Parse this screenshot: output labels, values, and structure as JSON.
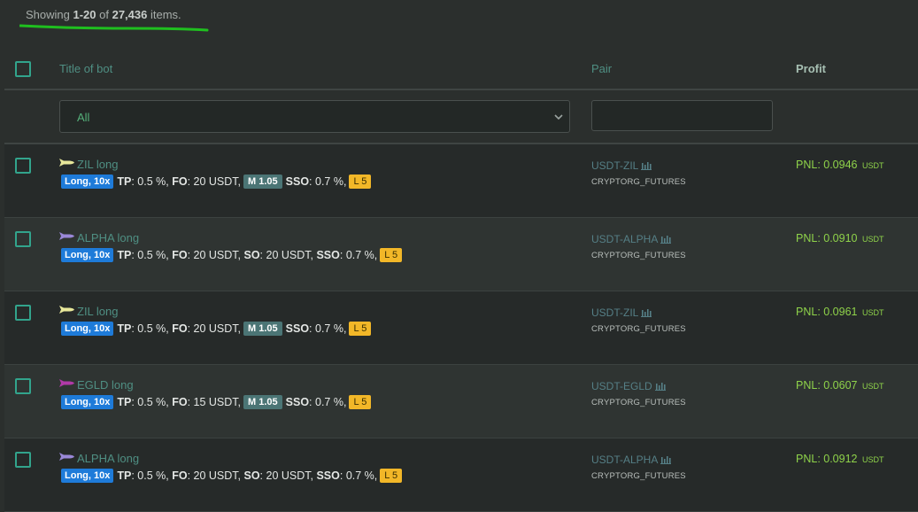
{
  "summary": {
    "prefix": "Showing ",
    "range": "1-20",
    "of": " of ",
    "total": "27,436",
    "suffix": " items."
  },
  "table": {
    "headers": {
      "title": "Title of bot",
      "pair": "Pair",
      "profit": "Profit"
    },
    "filter": {
      "select_value": "All",
      "pair_value": ""
    }
  },
  "rows": [
    {
      "icon_color": "#e8e89a",
      "title": "ZIL long",
      "direction": "Long, 10x",
      "tp_label": "TP",
      "tp": ": 0.5 %,",
      "fo_label": "FO",
      "fo": ": 20 USDT,",
      "m_badge": "M 1.05",
      "sso_label": "SSO",
      "sso": ": 0.7 %,",
      "l_badge": "L 5",
      "pair": "USDT-ZIL",
      "exchange": "CRYPTORG_FUTURES",
      "pnl": "PNL: 0.0946",
      "unit": "USDT"
    },
    {
      "icon_color": "#9a88d8",
      "title": "ALPHA long",
      "direction": "Long, 10x",
      "tp_label": "TP",
      "tp": ": 0.5 %,",
      "fo_label": "FO",
      "fo": ": 20 USDT,",
      "so_label": "SO",
      "so": ": 20 USDT,",
      "sso_label": "SSO",
      "sso": ": 0.7 %,",
      "l_badge": "L 5",
      "pair": "USDT-ALPHA",
      "exchange": "CRYPTORG_FUTURES",
      "pnl": "PNL: 0.0910",
      "unit": "USDT"
    },
    {
      "icon_color": "#e8e89a",
      "title": "ZIL long",
      "direction": "Long, 10x",
      "tp_label": "TP",
      "tp": ": 0.5 %,",
      "fo_label": "FO",
      "fo": ": 20 USDT,",
      "m_badge": "M 1.05",
      "sso_label": "SSO",
      "sso": ": 0.7 %,",
      "l_badge": "L 5",
      "pair": "USDT-ZIL",
      "exchange": "CRYPTORG_FUTURES",
      "pnl": "PNL: 0.0961",
      "unit": "USDT"
    },
    {
      "icon_color": "#b13aa8",
      "title": "EGLD long",
      "direction": "Long, 10x",
      "tp_label": "TP",
      "tp": ": 0.5 %,",
      "fo_label": "FO",
      "fo": ": 15 USDT,",
      "m_badge": "M 1.05",
      "sso_label": "SSO",
      "sso": ": 0.7 %,",
      "l_badge": "L 5",
      "pair": "USDT-EGLD",
      "exchange": "CRYPTORG_FUTURES",
      "pnl": "PNL: 0.0607",
      "unit": "USDT"
    },
    {
      "icon_color": "#9a88d8",
      "title": "ALPHA long",
      "direction": "Long, 10x",
      "tp_label": "TP",
      "tp": ": 0.5 %,",
      "fo_label": "FO",
      "fo": ": 20 USDT,",
      "so_label": "SO",
      "so": ": 20 USDT,",
      "sso_label": "SSO",
      "sso": ": 0.7 %,",
      "l_badge": "L 5",
      "pair": "USDT-ALPHA",
      "exchange": "CRYPTORG_FUTURES",
      "pnl": "PNL: 0.0912",
      "unit": "USDT"
    }
  ],
  "colors": {
    "accent": "#32a48c",
    "pnl": "#8fd34a",
    "underline": "#1fbf1f"
  },
  "icons": {
    "bot": "rocket-icon",
    "chart": "bar-chart-icon",
    "dropdown": "chevron-down-icon"
  }
}
